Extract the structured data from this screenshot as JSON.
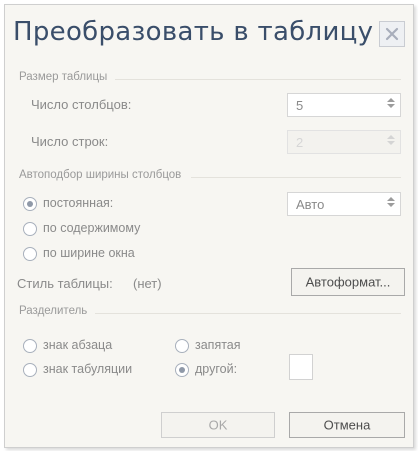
{
  "dialog": {
    "title": "Преобразовать в таблицу",
    "table_size": {
      "group_label": "Размер таблицы",
      "columns_label": "Число столбцов:",
      "columns_value": "5",
      "rows_label": "Число строк:",
      "rows_value": "2"
    },
    "autofit": {
      "group_label": "Автоподбор ширины столбцов",
      "options": [
        {
          "label": "постоянная:",
          "checked": true
        },
        {
          "label": "по содержимому",
          "checked": false
        },
        {
          "label": "по ширине окна",
          "checked": false
        }
      ],
      "fixed_width_value": "Авто"
    },
    "table_style": {
      "label": "Стиль таблицы:",
      "value": "(нет)",
      "autoformat_button": "Автоформат..."
    },
    "separator": {
      "group_label": "Разделитель",
      "options": [
        {
          "label": "знак абзаца",
          "checked": false
        },
        {
          "label": "запятая",
          "checked": false
        },
        {
          "label": "знак табуляции",
          "checked": false
        },
        {
          "label": "другой:",
          "checked": true
        }
      ],
      "other_value": ""
    },
    "buttons": {
      "ok": "OK",
      "cancel": "Отмена"
    }
  }
}
